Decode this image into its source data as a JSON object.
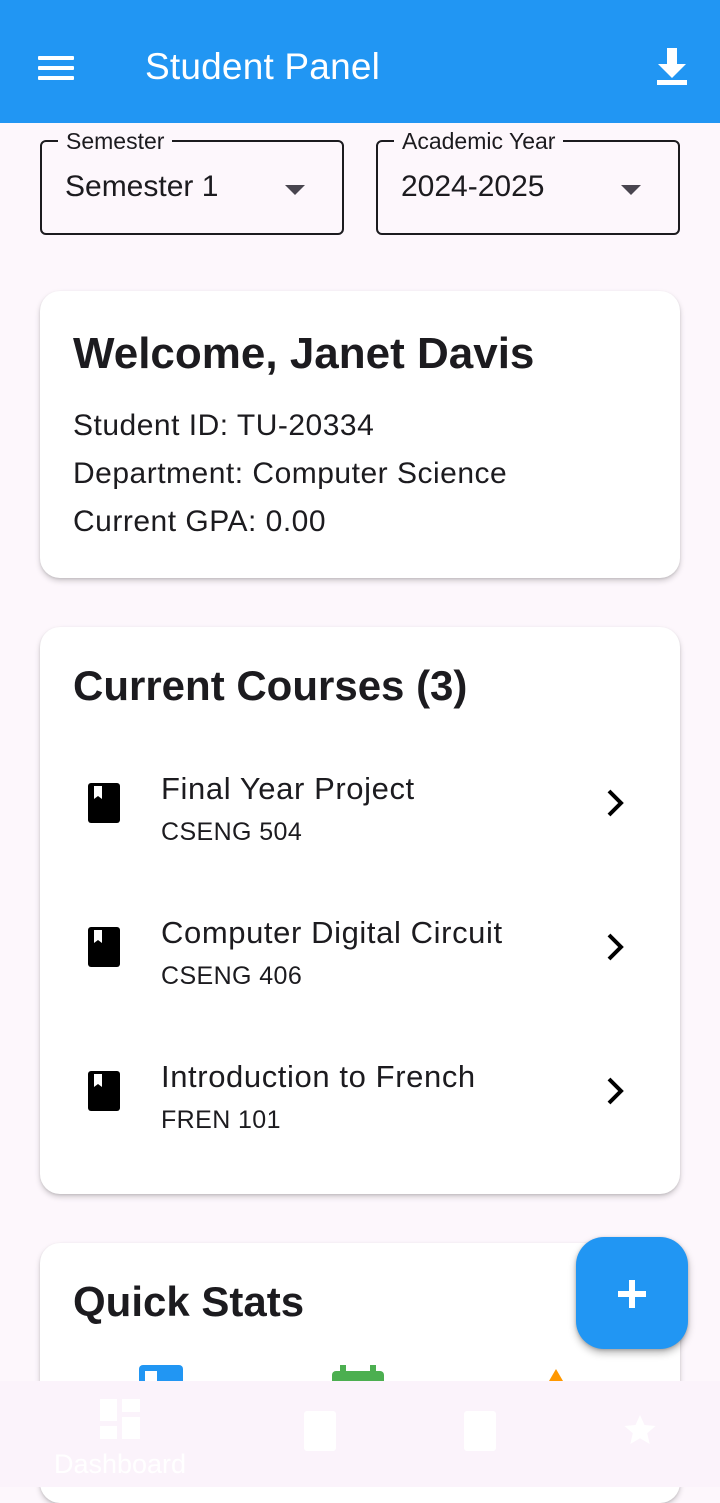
{
  "app_bar": {
    "title": "Student Panel",
    "background": "#2196f3",
    "menu_icon": "menu-icon",
    "action_icon": "download-icon"
  },
  "filters": {
    "semester": {
      "label": "Semester",
      "value": "Semester 1"
    },
    "academic_year": {
      "label": "Academic Year",
      "value": "2024-2025"
    }
  },
  "welcome": {
    "heading": "Welcome, Janet Davis",
    "student_id": "Student ID: TU-20334",
    "department": "Department: Computer Science",
    "gpa": "Current GPA: 0.00"
  },
  "courses": {
    "heading": "Current Courses (3)",
    "items": [
      {
        "title": "Final Year Project",
        "code": "CSENG 504",
        "icon": "book-icon"
      },
      {
        "title": "Computer Digital Circuit",
        "code": "CSENG 406",
        "icon": "book-icon"
      },
      {
        "title": "Introduction to French",
        "code": "FREN 101",
        "icon": "book-icon"
      }
    ]
  },
  "quick_stats": {
    "heading": "Quick Stats",
    "icons": [
      {
        "icon": "dashboard-icon",
        "color": "#2196f3"
      },
      {
        "icon": "calendar-icon",
        "color": "#4caf50"
      },
      {
        "icon": "trend-icon",
        "color": "#ff9800"
      }
    ]
  },
  "fab": {
    "icon": "add-icon"
  },
  "bottom_nav": {
    "items": [
      {
        "label": "Dashboard",
        "icon": "dashboard-icon"
      },
      {
        "label": "",
        "icon": "book-icon"
      },
      {
        "label": "",
        "icon": "book-icon"
      },
      {
        "label": "",
        "icon": "star-icon"
      }
    ]
  }
}
